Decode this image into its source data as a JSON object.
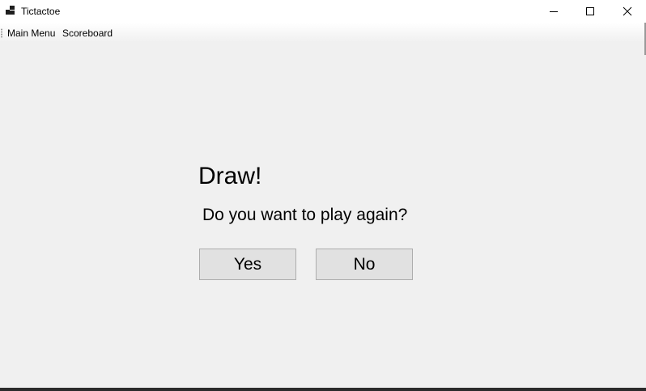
{
  "window": {
    "title": "Tictactoe",
    "app_icon": "app-icon",
    "controls": [
      "minimize-icon",
      "maximize-icon",
      "close-icon"
    ]
  },
  "menubar": {
    "items": [
      {
        "label": "Main Menu"
      },
      {
        "label": "Scoreboard"
      }
    ]
  },
  "dialog": {
    "heading": "Draw!",
    "question": "Do you want to play again?",
    "yes_label": "Yes",
    "no_label": "No"
  },
  "colors": {
    "background": "#f0f0f0",
    "button_face": "#e1e1e1",
    "button_border": "#adadad"
  }
}
